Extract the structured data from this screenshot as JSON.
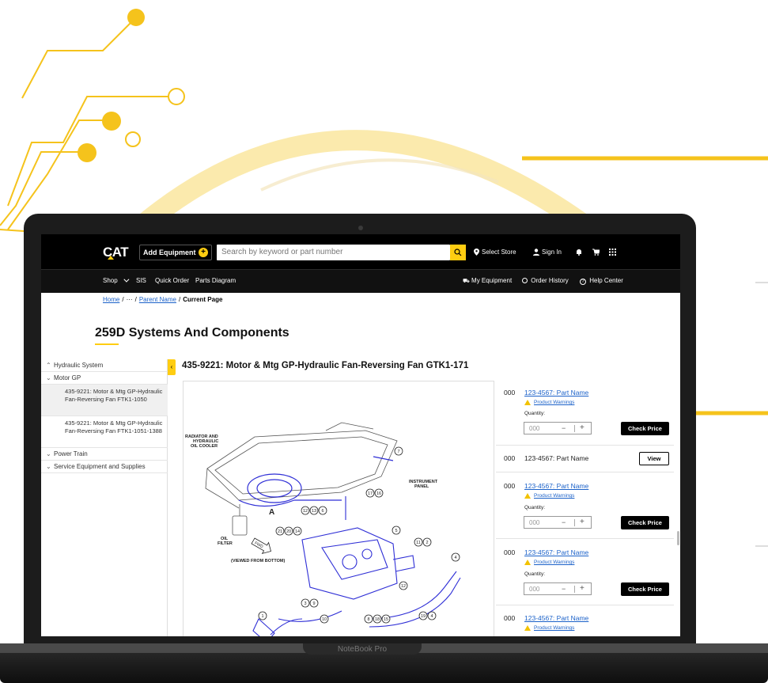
{
  "header": {
    "logo": "CAT",
    "add_equipment": "Add Equipment",
    "add_icon": "+",
    "search_placeholder": "Search by keyword or part number",
    "select_store": "Select Store",
    "sign_in": "Sign In"
  },
  "nav": {
    "shop": "Shop",
    "sis": "SIS",
    "quick_order": "Quick Order",
    "parts_diagram": "Parts Diagram",
    "my_equipment": "My Equipment",
    "order_history": "Order History",
    "help_center": "Help Center"
  },
  "breadcrumb": {
    "home": "Home",
    "ellipsis": "···",
    "parent": "Parent Name",
    "current": "Current Page",
    "sep": "/"
  },
  "page_title": "259D Systems And Components",
  "sidebar": {
    "collapse_icon": "‹",
    "items": [
      {
        "label": "Hydraulic System",
        "chevron": "^"
      },
      {
        "label": "Motor GP",
        "chevron": "v"
      },
      {
        "label": "435-9221: Motor & Mtg GP-Hydraulic Fan-Reversing Fan FTK1-1050"
      },
      {
        "label": "435-9221: Motor & Mtg GP-Hydraulic Fan-Reversing Fan FTK1-1051-1388"
      },
      {
        "label": "Power Train",
        "chevron": "v"
      },
      {
        "label": "Service Equipment and Supplies",
        "chevron": "v"
      }
    ]
  },
  "part_title": "435-9221: Motor & Mtg GP-Hydraulic Fan-Reversing Fan GTK1-171",
  "diagram": {
    "labels": {
      "radiator": [
        "RADIATOR AND",
        "HYDRAULIC",
        "OIL COOLER"
      ],
      "instrument": [
        "INSTRUMENT",
        "PANEL"
      ],
      "oil_filter": [
        "OIL",
        "FILTER"
      ],
      "fwd": "FWD",
      "viewed": "(VIEWED FROM BOTTOM)",
      "a": "A"
    },
    "callouts": [
      "7",
      "17",
      "16",
      "12",
      "13",
      "6",
      "21",
      "20",
      "14",
      "5",
      "11",
      "2",
      "4",
      "12",
      "1",
      "3",
      "9",
      "10",
      "8",
      "18",
      "15",
      "19",
      "4"
    ]
  },
  "parts": {
    "warning_label": "Product Warnings",
    "quantity_label": "Quantity:",
    "qty_value": "000",
    "check_price": "Check Price",
    "view": "View",
    "items": [
      {
        "num": "000",
        "name": "123-4567: Part Name"
      },
      {
        "num": "000",
        "name": "123-4567: Part Name"
      },
      {
        "num": "000",
        "name": "123-4567: Part Name"
      },
      {
        "num": "000",
        "name": "123-4567: Part Name"
      },
      {
        "num": "000",
        "name": "123-4567: Part Name"
      }
    ]
  },
  "laptop_brand": "NoteBook Pro",
  "colors": {
    "accent": "#ffcd11",
    "link": "#1c62c9",
    "header": "#000000"
  }
}
